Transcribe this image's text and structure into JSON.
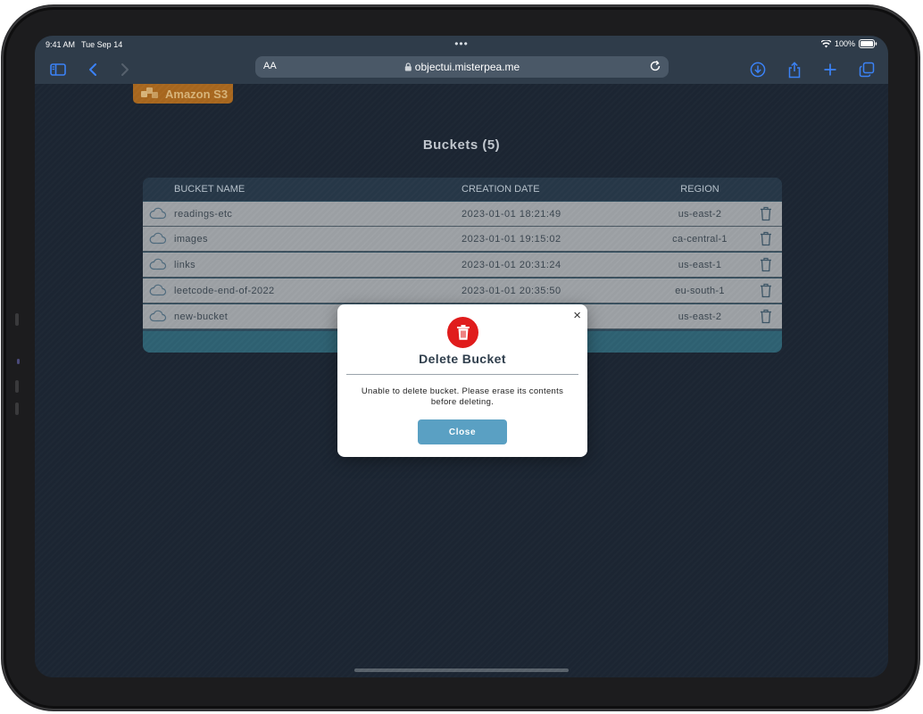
{
  "status_bar": {
    "time": "9:41 AM",
    "date": "Tue Sep 14",
    "dots": "•••",
    "battery": "100%"
  },
  "browser": {
    "text_size_label": "AA",
    "url": "objectui.misterpea.me",
    "icons": [
      "sidebar-icon",
      "back-icon",
      "forward-icon",
      "lock-icon",
      "reload-icon",
      "download-icon",
      "share-icon",
      "new-tab-icon",
      "tabs-icon"
    ]
  },
  "app": {
    "logo_text": "Amazon S3",
    "page_title": "Buckets (5)"
  },
  "table": {
    "headers": {
      "name": "BUCKET NAME",
      "date": "CREATION DATE",
      "region": "REGION"
    },
    "rows": [
      {
        "name": "readings-etc",
        "date": "2023-01-01 18:21:49",
        "region": "us-east-2"
      },
      {
        "name": "images",
        "date": "2023-01-01 19:15:02",
        "region": "ca-central-1"
      },
      {
        "name": "links",
        "date": "2023-01-01 20:31:24",
        "region": "us-east-1"
      },
      {
        "name": "leetcode-end-of-2022",
        "date": "2023-01-01 20:35:50",
        "region": "eu-south-1"
      },
      {
        "name": "new-bucket",
        "date": "",
        "region": "us-east-2"
      }
    ]
  },
  "modal": {
    "close_glyph": "×",
    "title": "Delete Bucket",
    "message": "Unable to delete bucket. Please erase its contents before deleting.",
    "button_label": "Close"
  },
  "colors": {
    "accent": "#5aa0c3",
    "danger": "#e01c1c",
    "logo": "#a9681f",
    "background": "#1c2633"
  }
}
